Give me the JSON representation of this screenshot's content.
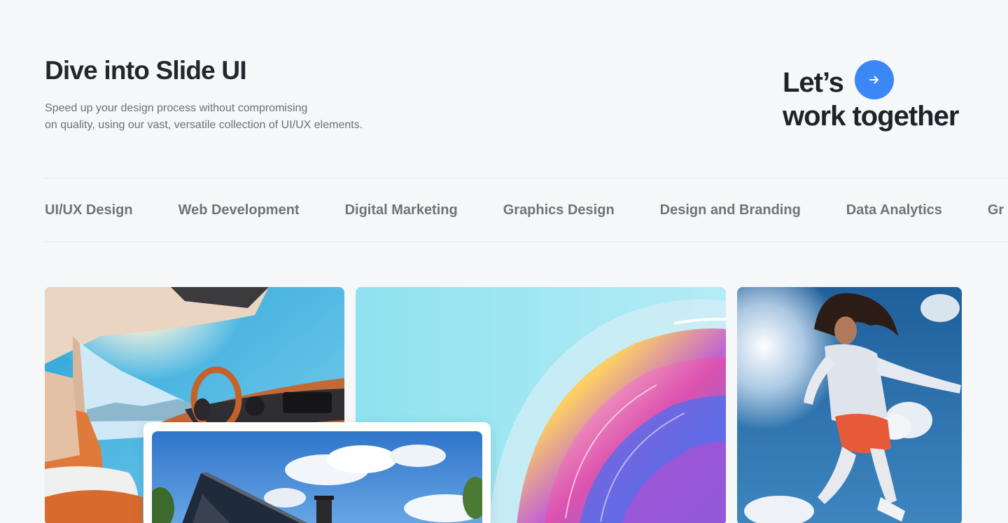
{
  "hero": {
    "title": "Dive into Slide UI",
    "description_line1": "Speed up your design process without compromising",
    "description_line2": "on quality, using our vast, versatile collection of UI/UX elements."
  },
  "cta": {
    "line1": "Let’s",
    "line2": "work together",
    "arrow_icon": "arrow-right-icon",
    "accent_color": "#3b87f5"
  },
  "tabs": [
    {
      "label": "UI/UX Design"
    },
    {
      "label": "Web Development"
    },
    {
      "label": "Digital Marketing"
    },
    {
      "label": "Graphics Design"
    },
    {
      "label": "Design and Branding"
    },
    {
      "label": "Data Analytics"
    },
    {
      "label": "Gr"
    }
  ],
  "gallery": {
    "images": [
      "car-interior-image",
      "glass-wave-image",
      "runner-image",
      "house-image"
    ]
  }
}
